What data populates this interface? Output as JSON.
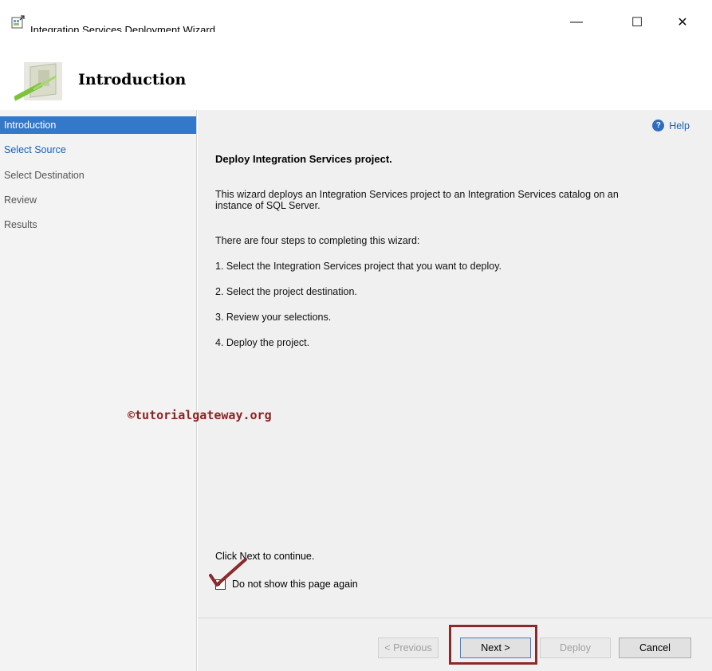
{
  "window": {
    "title": "Integration Services Deployment Wizard",
    "minimize_label": "—",
    "maximize_label": "☐",
    "close_label": "✕"
  },
  "header": {
    "title": "Introduction"
  },
  "sidebar": {
    "items": [
      {
        "label": "Introduction",
        "state": "active"
      },
      {
        "label": "Select Source",
        "state": "link"
      },
      {
        "label": "Select Destination",
        "state": "disabled"
      },
      {
        "label": "Review",
        "state": "disabled"
      },
      {
        "label": "Results",
        "state": "disabled"
      }
    ]
  },
  "main": {
    "help_label": "Help",
    "heading": "Deploy Integration Services project.",
    "description_line1": "This wizard deploys an Integration Services project to an Integration Services catalog on an",
    "description_line2": "instance of SQL Server.",
    "steps_intro": "There are four steps to completing this wizard:",
    "steps": [
      "1. Select the Integration Services project that you want to deploy.",
      "2. Select the project destination.",
      "3. Review your selections.",
      "4. Deploy the project."
    ],
    "continue_text": "Click Next to continue.",
    "dont_show_label": "Do not show this page again",
    "dont_show_checked": true
  },
  "watermark": "©tutorialgateway.org",
  "footer": {
    "previous_label": "< Previous",
    "next_label": "Next >",
    "deploy_label": "Deploy",
    "cancel_label": "Cancel"
  },
  "colors": {
    "active_nav": "#3478c9",
    "link": "#1a5fb4",
    "highlight_box": "#8a2a2a"
  }
}
